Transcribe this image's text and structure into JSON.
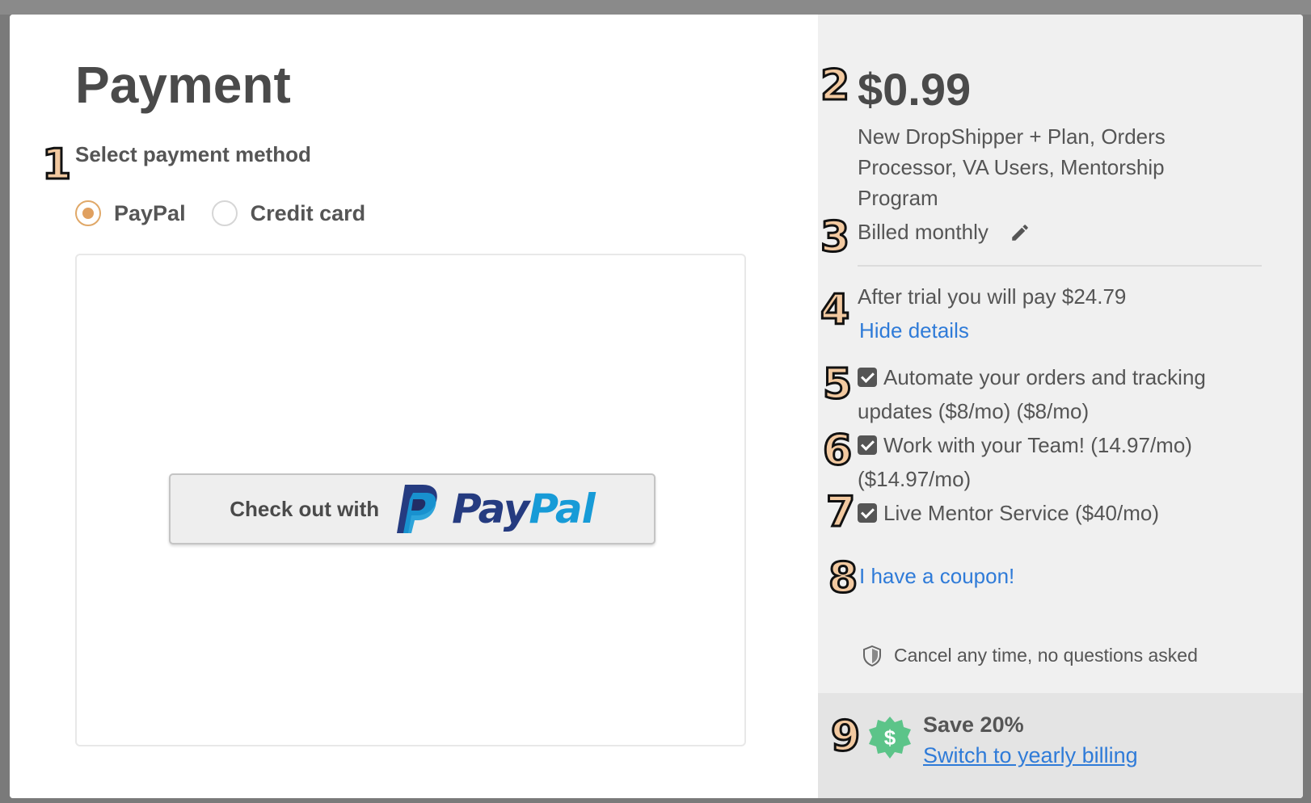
{
  "payment": {
    "title": "Payment",
    "method_label": "Select payment method",
    "options": [
      {
        "label": "PayPal",
        "selected": true
      },
      {
        "label": "Credit card",
        "selected": false
      }
    ],
    "paypal_button": {
      "prefix": "Check out with",
      "brand_pay": "Pay",
      "brand_pal": "Pal"
    }
  },
  "summary": {
    "price": "$0.99",
    "plan_description": "New DropShipper + Plan, Orders Processor, VA Users, Mentorship Program",
    "billing": "Billed monthly",
    "after_trial": "After trial you will pay $24.79",
    "hide_details": "Hide details",
    "addons": [
      {
        "label": "Automate your orders and tracking updates ($8/mo) ($8/mo)",
        "checked": true
      },
      {
        "label": "Work with your Team! (14.97/mo) ($14.97/mo)",
        "checked": true
      },
      {
        "label": "Live Mentor Service ($40/mo)",
        "checked": true
      }
    ],
    "coupon": "I have a coupon!",
    "cancel_note": "Cancel any time, no questions asked",
    "save": {
      "title": "Save 20%",
      "link": "Switch to yearly billing",
      "icon_symbol": "$"
    }
  },
  "badges": [
    "1",
    "2",
    "3",
    "4",
    "5",
    "6",
    "7",
    "8",
    "9"
  ],
  "colors": {
    "accent_radio": "#e0a060",
    "link": "#2f7bd8",
    "paypal_dark": "#253b80",
    "paypal_light": "#179bd7",
    "save_badge": "#5cc489",
    "badge_fill": "#f2c9a0"
  }
}
